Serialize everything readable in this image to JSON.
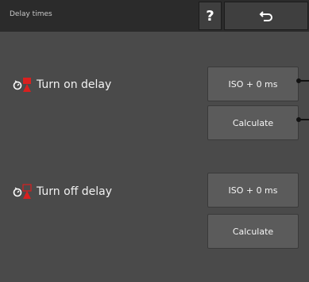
{
  "header": {
    "title": "Delay times",
    "help_label": "?",
    "back_icon": "undo-arrow-icon"
  },
  "rows": [
    {
      "label": "Turn on delay",
      "icon": "section-turn-on-icon",
      "value_button": "ISO + 0 ms",
      "calculate_button": "Calculate"
    },
    {
      "label": "Turn off delay",
      "icon": "section-turn-off-icon",
      "value_button": "ISO + 0 ms",
      "calculate_button": "Calculate"
    }
  ],
  "colors": {
    "header_bg": "#2b2b2b",
    "body_bg": "#4a4a4a",
    "button_bg": "#5b5b5b",
    "accent_red": "#d9201f"
  }
}
